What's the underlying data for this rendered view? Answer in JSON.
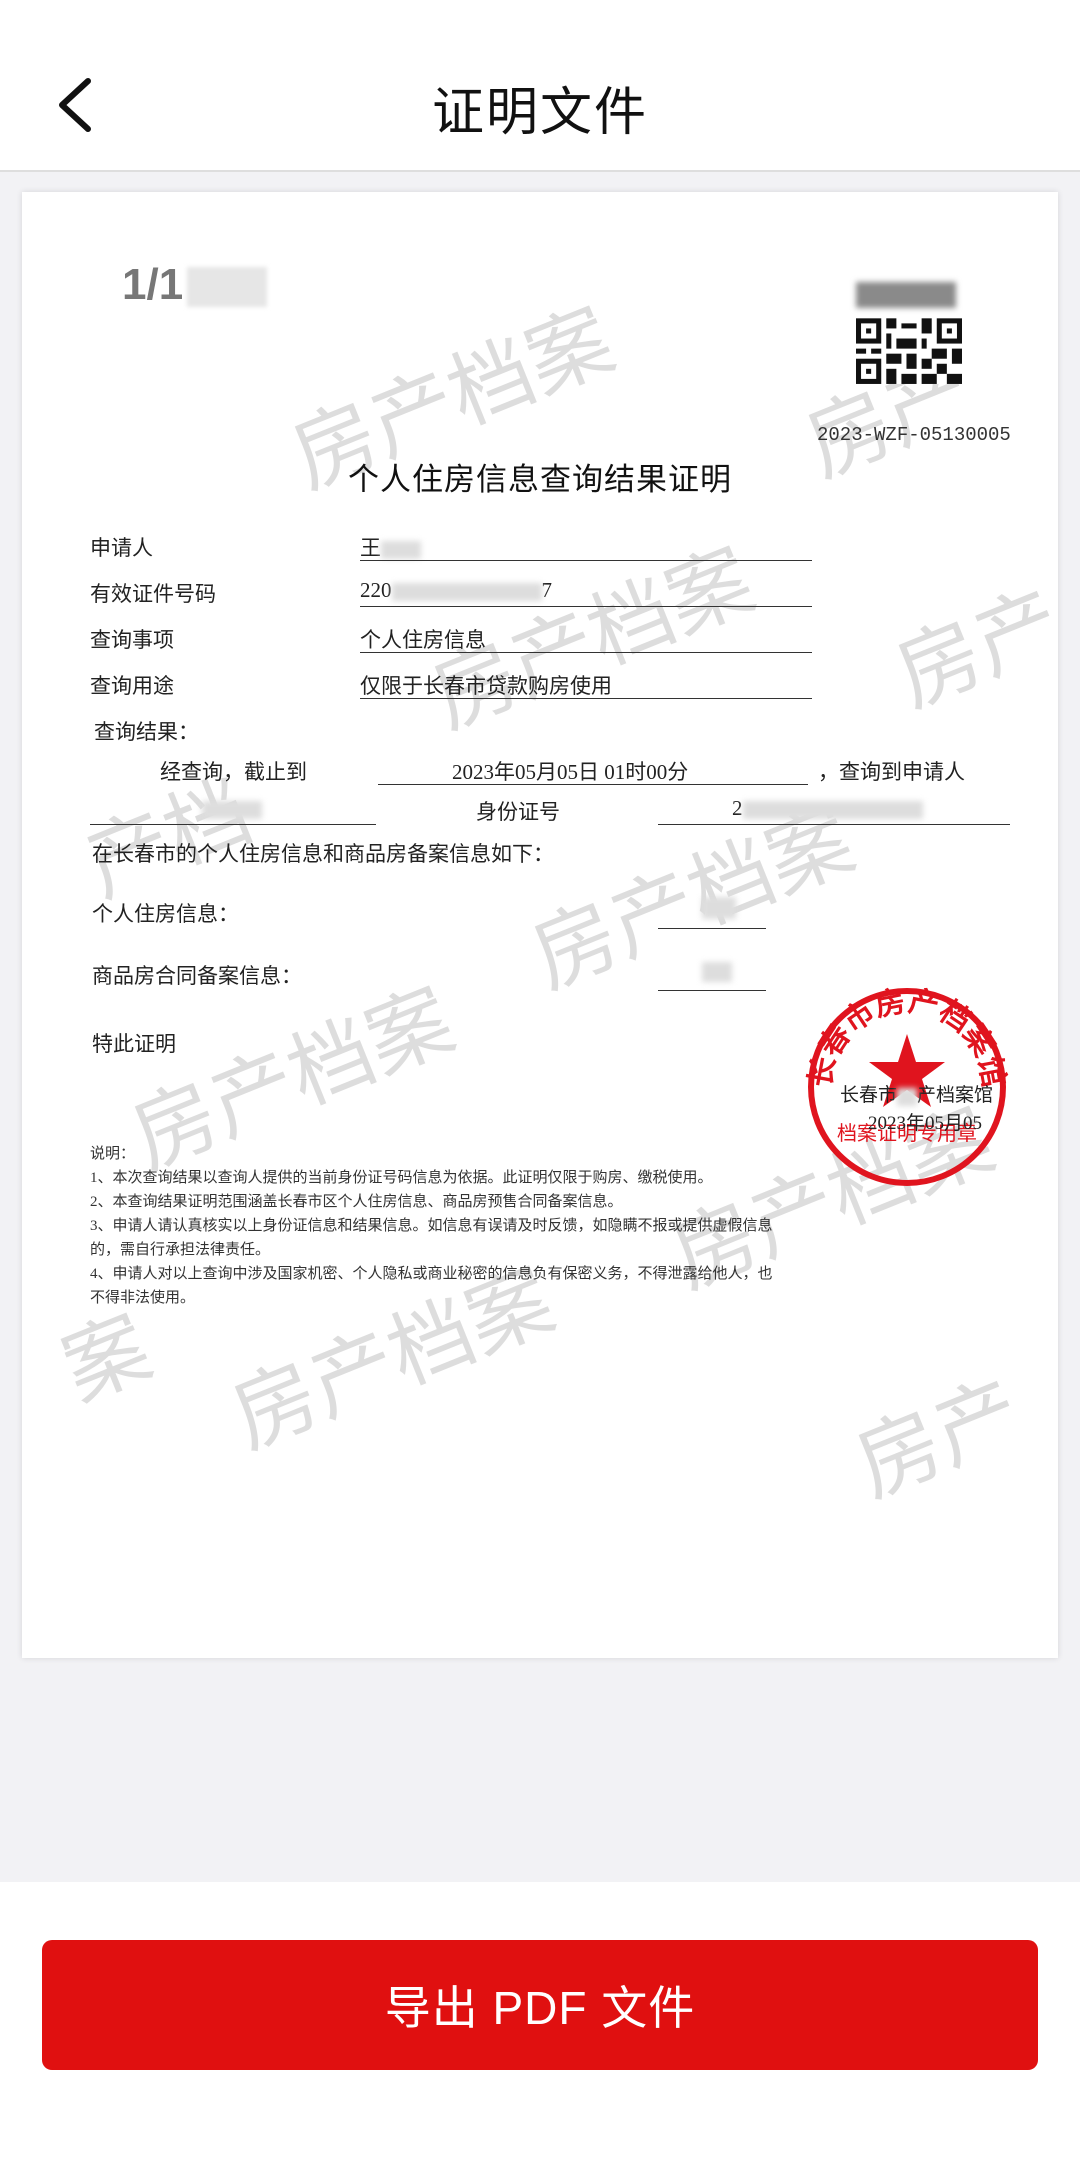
{
  "header": {
    "title": "证明文件"
  },
  "document": {
    "page_indicator": "1/1",
    "code": "2023-WZF-05130005",
    "title": "个人住房信息查询结果证明",
    "fields": [
      {
        "label": "申请人",
        "value": "王"
      },
      {
        "label": "有效证件号码",
        "value": "220",
        "value_suffix": "7"
      },
      {
        "label": "查询事项",
        "value": "个人住房信息"
      },
      {
        "label": "查询用途",
        "value": "仅限于长春市贷款购房使用"
      }
    ],
    "result_label": "查询结果：",
    "query_prefix": "经查询，截止到",
    "query_time": "2023年05月05日  01时00分",
    "query_suffix": "，查询到申请人",
    "id_label": "身份证号",
    "id_value_prefix": "2",
    "intro": "在长春市的个人住房信息和商品房备案信息如下：",
    "personal_housing_label": "个人住房信息：",
    "contract_label": "商品房合同备案信息：",
    "certify": "特此证明",
    "notes_title": "说明：",
    "notes": [
      "1、本次查询结果以查询人提供的当前身份证号码信息为依据。此证明仅限于购房、缴税使用。",
      "2、本查询结果证明范围涵盖长春市区个人住房信息、商品房预售合同备案信息。",
      "3、申请人请认真核实以上身份证信息和结果信息。如信息有误请及时反馈，如隐瞒不报或提供虚假信息",
      "的，需自行承担法律责任。",
      "4、申请人对以上查询中涉及国家机密、个人隐私或商业秘密的信息负有保密义务，不得泄露给他人，也",
      "不得非法使用。"
    ],
    "seal": {
      "ring_text": "长春市房产档案馆",
      "bottom_text": "档案证明专用章",
      "org_text": "长春市",
      "org_text_suffix": "产档案馆",
      "date": "2023年05月05"
    },
    "watermark": "房产档案",
    "watermark_partial_1": "房产",
    "watermark_partial_2": "产档",
    "watermark_partial_3": "案"
  },
  "footer": {
    "export_label": "导出 PDF 文件"
  },
  "colors": {
    "accent": "#e01010",
    "seal": "#e0141e"
  },
  "icons": {
    "back": "chevron-left-icon",
    "seal_star": "star-icon"
  }
}
